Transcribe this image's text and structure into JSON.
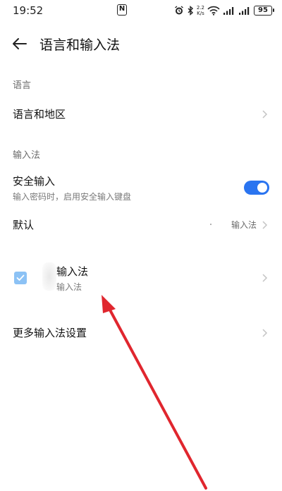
{
  "status_bar": {
    "time": "19:52",
    "nfc_symbol": "N",
    "net_speed_value": "2.2",
    "net_speed_unit": "K/s",
    "battery": "95",
    "icons": [
      "nfc-icon",
      "alarm-icon",
      "bluetooth-icon",
      "wifi-icon",
      "signal-icon",
      "signal-icon",
      "battery-icon"
    ]
  },
  "header": {
    "title": "语言和输入法",
    "back_icon": "back-arrow-icon"
  },
  "sections": {
    "language_label": "语言",
    "input_label": "输入法"
  },
  "rows": {
    "language_region": {
      "title": "语言和地区"
    },
    "secure_input": {
      "title": "安全输入",
      "subtitle": "输入密码时，启用安全输入键盘",
      "enabled": true
    },
    "default": {
      "title": "默认",
      "value": "输入法"
    },
    "ime": {
      "title": "输入法",
      "subtitle": "输入法",
      "checked": true
    },
    "more_settings": {
      "title": "更多输入法设置"
    }
  },
  "colors": {
    "accent": "#2a74f0",
    "checkbox": "#8cc2f5",
    "annotation_arrow": "#e0262e"
  }
}
